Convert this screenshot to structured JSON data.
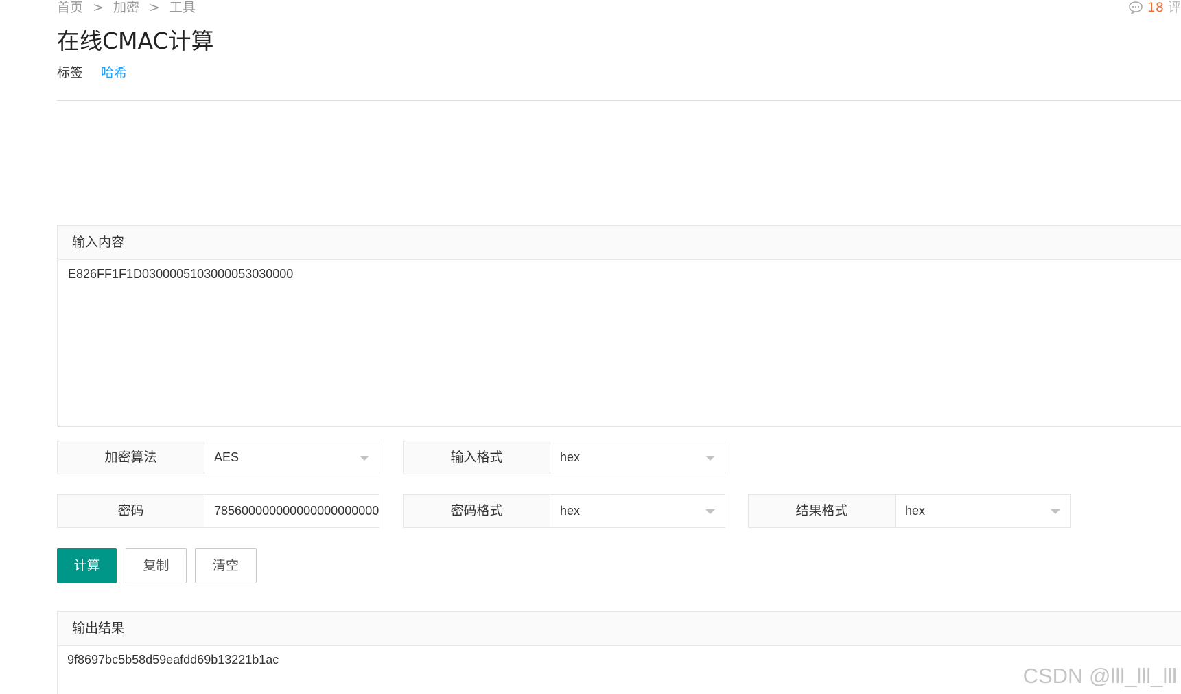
{
  "breadcrumb": {
    "items": [
      "首页",
      "加密",
      "工具"
    ],
    "separator": ">"
  },
  "comments": {
    "count": "18",
    "label_partial": "评"
  },
  "page_title": "在线CMAC计算",
  "tags": {
    "label": "标签",
    "items": [
      "哈希"
    ]
  },
  "input_panel": {
    "title": "输入内容",
    "value": "E826FF1F1D0300005103000053030000"
  },
  "form": {
    "algorithm": {
      "label": "加密算法",
      "value": "AES"
    },
    "input_format": {
      "label": "输入格式",
      "value": "hex"
    },
    "key": {
      "label": "密码",
      "value": "7856000000000000000000000"
    },
    "key_format": {
      "label": "密码格式",
      "value": "hex"
    },
    "result_format": {
      "label": "结果格式",
      "value": "hex"
    }
  },
  "buttons": {
    "calculate": "计算",
    "copy": "复制",
    "clear": "清空"
  },
  "output_panel": {
    "title": "输出结果",
    "value": "9f8697bc5b58d59eafdd69b13221b1ac"
  },
  "watermark": "CSDN @lll_lll_lll",
  "colors": {
    "primary_button": "#009688",
    "tag_link": "#1e9fff",
    "comment_count": "#e8713c"
  },
  "icons": {
    "comments": "comment-bubble-icon",
    "select_arrow": "caret-down-icon"
  }
}
